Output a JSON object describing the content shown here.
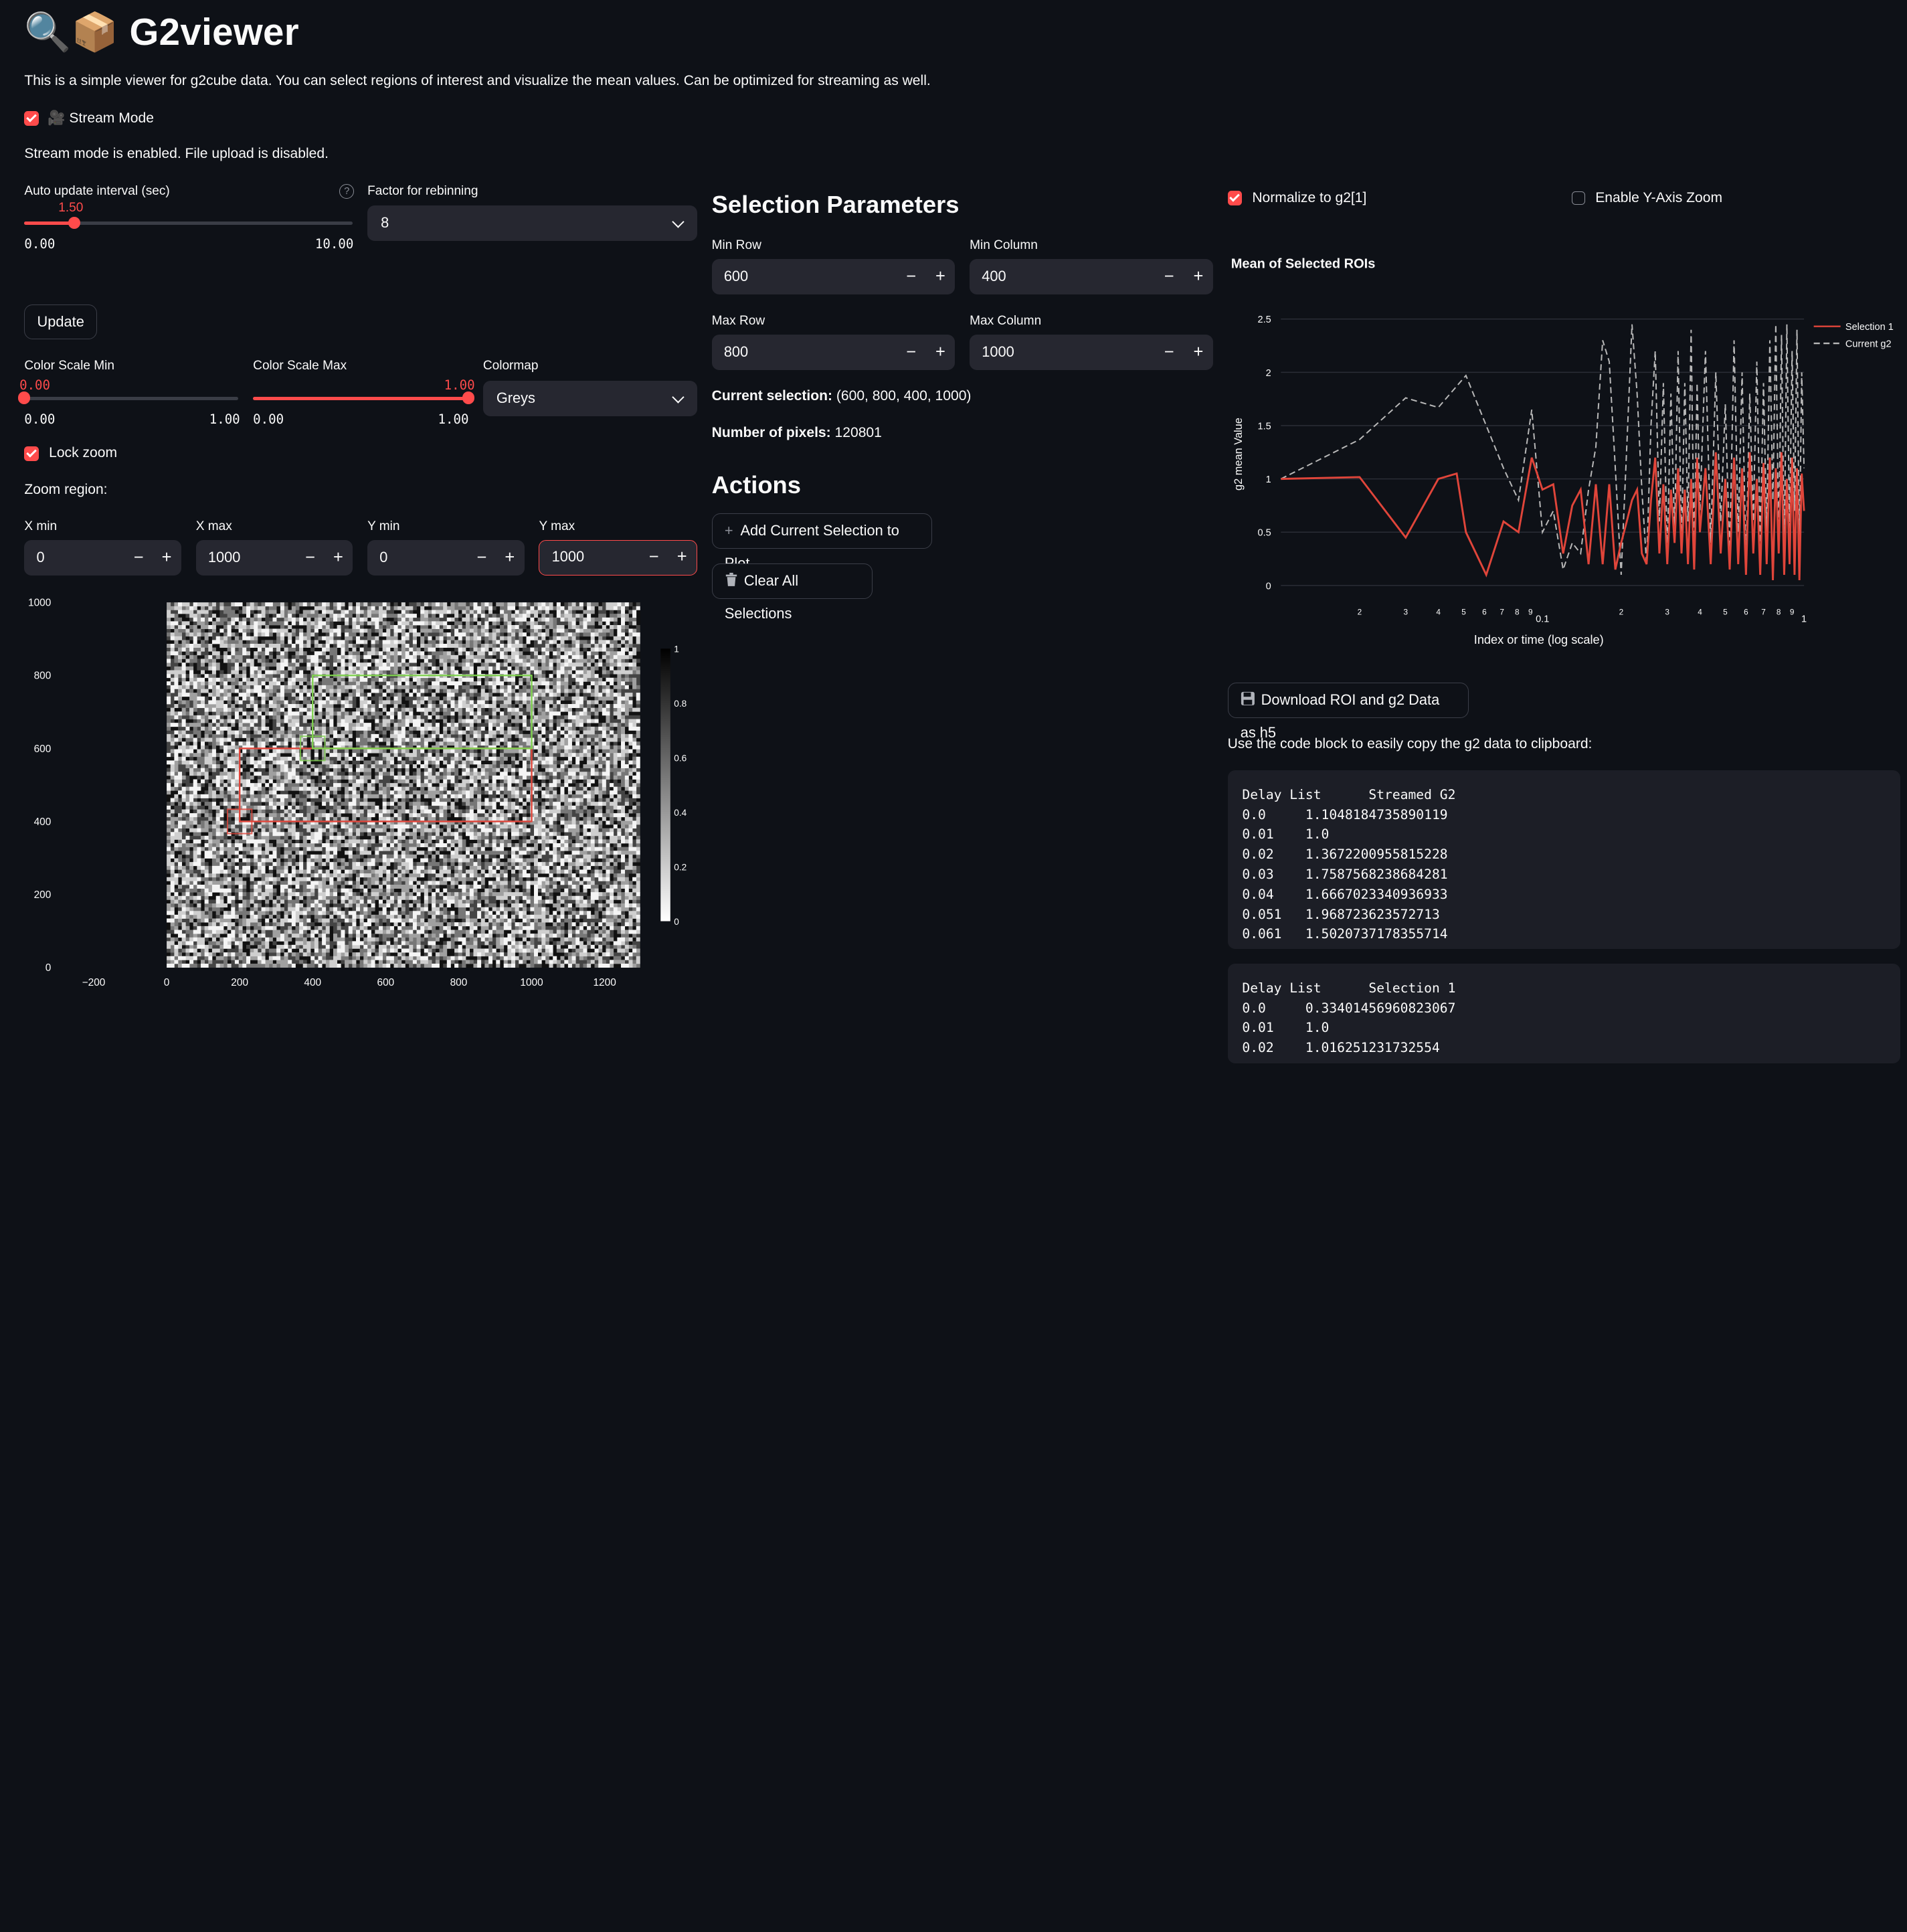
{
  "app": {
    "title": "G2viewer",
    "title_icons": "🔍📦",
    "description": "This is a simple viewer for g2cube data. You can select regions of interest and visualize the mean values. Can be optimized for streaming as well."
  },
  "stream": {
    "checkbox_icon": "🎥",
    "checkbox_label": "Stream Mode",
    "checked": true,
    "info": "Stream mode is enabled. File upload is disabled."
  },
  "auto_update": {
    "label": "Auto update interval (sec)",
    "value": "1.50",
    "min": "0.00",
    "max": "10.00",
    "fraction": 0.15,
    "help_icon": "question-circle-icon"
  },
  "rebin": {
    "label": "Factor for rebinning",
    "value": "8"
  },
  "update_button": "Update",
  "color_scale_min": {
    "label": "Color Scale Min",
    "value": "0.00",
    "min": "0.00",
    "max": "1.00",
    "fraction": 0.0
  },
  "color_scale_max": {
    "label": "Color Scale Max",
    "value": "1.00",
    "min": "0.00",
    "max": "1.00",
    "fraction": 1.0
  },
  "colormap": {
    "label": "Colormap",
    "value": "Greys"
  },
  "lock_zoom": {
    "label": "Lock zoom",
    "checked": true
  },
  "zoom_region_label": "Zoom region:",
  "zoom": {
    "xmin": {
      "label": "X min",
      "value": "0"
    },
    "xmax": {
      "label": "X max",
      "value": "1000"
    },
    "ymin": {
      "label": "Y min",
      "value": "0"
    },
    "ymax": {
      "label": "Y max",
      "value": "1000"
    }
  },
  "stepper": {
    "minus": "−",
    "plus": "+"
  },
  "heatmap": {
    "y_ticks": [
      "0",
      "200",
      "400",
      "600",
      "800",
      "1000"
    ],
    "x_ticks": [
      "−200",
      "0",
      "200",
      "400",
      "600",
      "800",
      "1000",
      "1200"
    ],
    "colorbar_ticks": [
      "0",
      "0.2",
      "0.4",
      "0.6",
      "0.8",
      "1"
    ],
    "rois": [
      {
        "name": "Selection 1",
        "min_row": 400,
        "max_row": 600,
        "min_col": 200,
        "max_col": 1000,
        "color": "#e0453a"
      },
      {
        "name": "Current selection",
        "min_row": 600,
        "max_row": 800,
        "min_col": 400,
        "max_col": 1000,
        "color": "#7fd14f"
      }
    ]
  },
  "selection": {
    "title": "Selection Parameters",
    "min_row": {
      "label": "Min Row",
      "value": "600"
    },
    "min_col": {
      "label": "Min Column",
      "value": "400"
    },
    "max_row": {
      "label": "Max Row",
      "value": "800"
    },
    "max_col": {
      "label": "Max Column",
      "value": "1000"
    },
    "current_label": "Current selection:",
    "current_value": "(600, 800, 400, 1000)",
    "pixels_label": "Number of pixels:",
    "pixels_value": "120801"
  },
  "actions": {
    "title": "Actions",
    "add_icon": "plus-icon",
    "add": "Add Current Selection to Plot",
    "clear_icon": "trash-icon",
    "clear": "Clear All Selections"
  },
  "options": {
    "normalize": {
      "label": "Normalize to g2[1]",
      "checked": true
    },
    "yzoom": {
      "label": "Enable Y-Axis Zoom",
      "checked": false
    }
  },
  "chart_data": {
    "type": "line",
    "title": "Mean of Selected ROIs",
    "xlabel": "Index or time (log scale)",
    "ylabel": "g2 mean Value",
    "x_scale": "log",
    "xlim": [
      0.01,
      1.0
    ],
    "ylim": [
      0,
      2.5
    ],
    "y_ticks": [
      "0",
      "0.5",
      "1",
      "1.5",
      "2",
      "2.5"
    ],
    "x_ticks": [
      {
        "v": 0.02,
        "t": "2"
      },
      {
        "v": 0.03,
        "t": "3"
      },
      {
        "v": 0.04,
        "t": "4"
      },
      {
        "v": 0.05,
        "t": "5"
      },
      {
        "v": 0.06,
        "t": "6"
      },
      {
        "v": 0.07,
        "t": "7"
      },
      {
        "v": 0.08,
        "t": "8"
      },
      {
        "v": 0.09,
        "t": "9"
      },
      {
        "v": 0.1,
        "t": "0.1"
      },
      {
        "v": 0.2,
        "t": "2"
      },
      {
        "v": 0.3,
        "t": "3"
      },
      {
        "v": 0.4,
        "t": "4"
      },
      {
        "v": 0.5,
        "t": "5"
      },
      {
        "v": 0.6,
        "t": "6"
      },
      {
        "v": 0.7,
        "t": "7"
      },
      {
        "v": 0.8,
        "t": "8"
      },
      {
        "v": 0.9,
        "t": "9"
      },
      {
        "v": 1.0,
        "t": "1"
      }
    ],
    "legend_position": "top-right",
    "series": [
      {
        "name": "Selection 1",
        "color": "#e0453a",
        "dash": false,
        "points": [
          [
            0.01,
            1.0
          ],
          [
            0.02,
            1.017
          ],
          [
            0.03,
            0.45
          ],
          [
            0.04,
            1.0
          ],
          [
            0.047,
            1.05
          ],
          [
            0.051,
            0.5
          ],
          [
            0.061,
            0.1
          ],
          [
            0.071,
            0.6
          ],
          [
            0.081,
            0.5
          ],
          [
            0.091,
            1.2
          ],
          [
            0.1,
            0.9
          ],
          [
            0.11,
            0.95
          ],
          [
            0.12,
            0.3
          ],
          [
            0.13,
            0.75
          ],
          [
            0.14,
            0.9
          ],
          [
            0.15,
            0.2
          ],
          [
            0.16,
            0.95
          ],
          [
            0.17,
            0.2
          ],
          [
            0.18,
            0.95
          ],
          [
            0.19,
            0.15
          ],
          [
            0.2,
            0.4
          ],
          [
            0.21,
            0.6
          ],
          [
            0.22,
            0.8
          ],
          [
            0.23,
            0.9
          ],
          [
            0.24,
            0.3
          ],
          [
            0.25,
            0.2
          ],
          [
            0.26,
            0.8
          ],
          [
            0.27,
            1.2
          ],
          [
            0.28,
            0.3
          ],
          [
            0.29,
            0.95
          ],
          [
            0.3,
            0.2
          ],
          [
            0.31,
            0.9
          ],
          [
            0.32,
            0.4
          ],
          [
            0.33,
            1.1
          ],
          [
            0.34,
            0.3
          ],
          [
            0.35,
            0.9
          ],
          [
            0.36,
            0.2
          ],
          [
            0.37,
            1.0
          ],
          [
            0.38,
            0.15
          ],
          [
            0.39,
            1.2
          ],
          [
            0.4,
            0.5
          ],
          [
            0.42,
            1.1
          ],
          [
            0.44,
            0.2
          ],
          [
            0.46,
            1.25
          ],
          [
            0.48,
            0.3
          ],
          [
            0.5,
            1.0
          ],
          [
            0.52,
            0.15
          ],
          [
            0.54,
            1.2
          ],
          [
            0.56,
            0.2
          ],
          [
            0.58,
            1.1
          ],
          [
            0.6,
            0.1
          ],
          [
            0.62,
            1.25
          ],
          [
            0.64,
            0.3
          ],
          [
            0.66,
            1.0
          ],
          [
            0.68,
            0.1
          ],
          [
            0.7,
            1.15
          ],
          [
            0.72,
            0.2
          ],
          [
            0.74,
            1.2
          ],
          [
            0.76,
            0.05
          ],
          [
            0.78,
            1.1
          ],
          [
            0.8,
            0.3
          ],
          [
            0.82,
            1.25
          ],
          [
            0.84,
            0.1
          ],
          [
            0.86,
            1.0
          ],
          [
            0.88,
            0.2
          ],
          [
            0.9,
            1.2
          ],
          [
            0.92,
            0.1
          ],
          [
            0.94,
            1.1
          ],
          [
            0.96,
            0.05
          ],
          [
            0.98,
            1.05
          ],
          [
            1.0,
            0.7
          ]
        ]
      },
      {
        "name": "Current g2",
        "color": "#b8b8b8",
        "dash": true,
        "points": [
          [
            0.01,
            1.0
          ],
          [
            0.02,
            1.37
          ],
          [
            0.03,
            1.76
          ],
          [
            0.04,
            1.67
          ],
          [
            0.051,
            1.97
          ],
          [
            0.061,
            1.5
          ],
          [
            0.071,
            1.1
          ],
          [
            0.081,
            0.8
          ],
          [
            0.091,
            1.65
          ],
          [
            0.1,
            0.5
          ],
          [
            0.11,
            0.7
          ],
          [
            0.12,
            0.15
          ],
          [
            0.13,
            0.4
          ],
          [
            0.14,
            0.3
          ],
          [
            0.15,
            0.9
          ],
          [
            0.16,
            1.3
          ],
          [
            0.17,
            2.3
          ],
          [
            0.18,
            2.1
          ],
          [
            0.19,
            1.1
          ],
          [
            0.2,
            0.1
          ],
          [
            0.21,
            1.3
          ],
          [
            0.22,
            2.45
          ],
          [
            0.23,
            1.8
          ],
          [
            0.24,
            0.9
          ],
          [
            0.25,
            0.2
          ],
          [
            0.26,
            1.5
          ],
          [
            0.27,
            2.2
          ],
          [
            0.28,
            0.6
          ],
          [
            0.29,
            1.9
          ],
          [
            0.3,
            0.3
          ],
          [
            0.31,
            1.8
          ],
          [
            0.32,
            0.5
          ],
          [
            0.33,
            2.2
          ],
          [
            0.34,
            0.4
          ],
          [
            0.35,
            1.9
          ],
          [
            0.36,
            0.6
          ],
          [
            0.37,
            2.4
          ],
          [
            0.38,
            0.3
          ],
          [
            0.39,
            1.9
          ],
          [
            0.4,
            0.7
          ],
          [
            0.42,
            2.2
          ],
          [
            0.44,
            0.4
          ],
          [
            0.46,
            2.0
          ],
          [
            0.48,
            0.6
          ],
          [
            0.5,
            1.7
          ],
          [
            0.52,
            0.3
          ],
          [
            0.54,
            2.3
          ],
          [
            0.56,
            0.5
          ],
          [
            0.58,
            2.0
          ],
          [
            0.6,
            0.2
          ],
          [
            0.62,
            1.8
          ],
          [
            0.64,
            0.6
          ],
          [
            0.66,
            2.1
          ],
          [
            0.68,
            0.4
          ],
          [
            0.7,
            1.9
          ],
          [
            0.72,
            0.5
          ],
          [
            0.74,
            2.3
          ],
          [
            0.76,
            0.8
          ],
          [
            0.78,
            2.45
          ],
          [
            0.8,
            0.4
          ],
          [
            0.82,
            2.35
          ],
          [
            0.84,
            0.3
          ],
          [
            0.86,
            2.45
          ],
          [
            0.88,
            0.5
          ],
          [
            0.9,
            2.2
          ],
          [
            0.92,
            0.7
          ],
          [
            0.94,
            2.4
          ],
          [
            0.96,
            0.3
          ],
          [
            0.98,
            2.0
          ],
          [
            1.0,
            1.1
          ]
        ]
      }
    ]
  },
  "download": {
    "icon": "floppy-disk-icon",
    "label": "Download ROI and g2 Data as h5"
  },
  "code_hint": "Use the code block to easily copy the g2 data to clipboard:",
  "code_g2": {
    "header_a": "Delay List",
    "header_b": "Streamed G2",
    "rows": [
      [
        "0.0",
        "1.1048184735890119"
      ],
      [
        "0.01",
        "1.0"
      ],
      [
        "0.02",
        "1.3672200955815228"
      ],
      [
        "0.03",
        "1.7587568238684281"
      ],
      [
        "0.04",
        "1.6667023340936933"
      ],
      [
        "0.051",
        "1.968723623572713"
      ],
      [
        "0.061",
        "1.5020737178355714"
      ]
    ]
  },
  "code_sel": {
    "header_a": "Delay List",
    "header_b": "Selection 1",
    "rows": [
      [
        "0.0",
        "0.33401456960823067"
      ],
      [
        "0.01",
        "1.0"
      ],
      [
        "0.02",
        "1.016251231732554"
      ]
    ]
  }
}
